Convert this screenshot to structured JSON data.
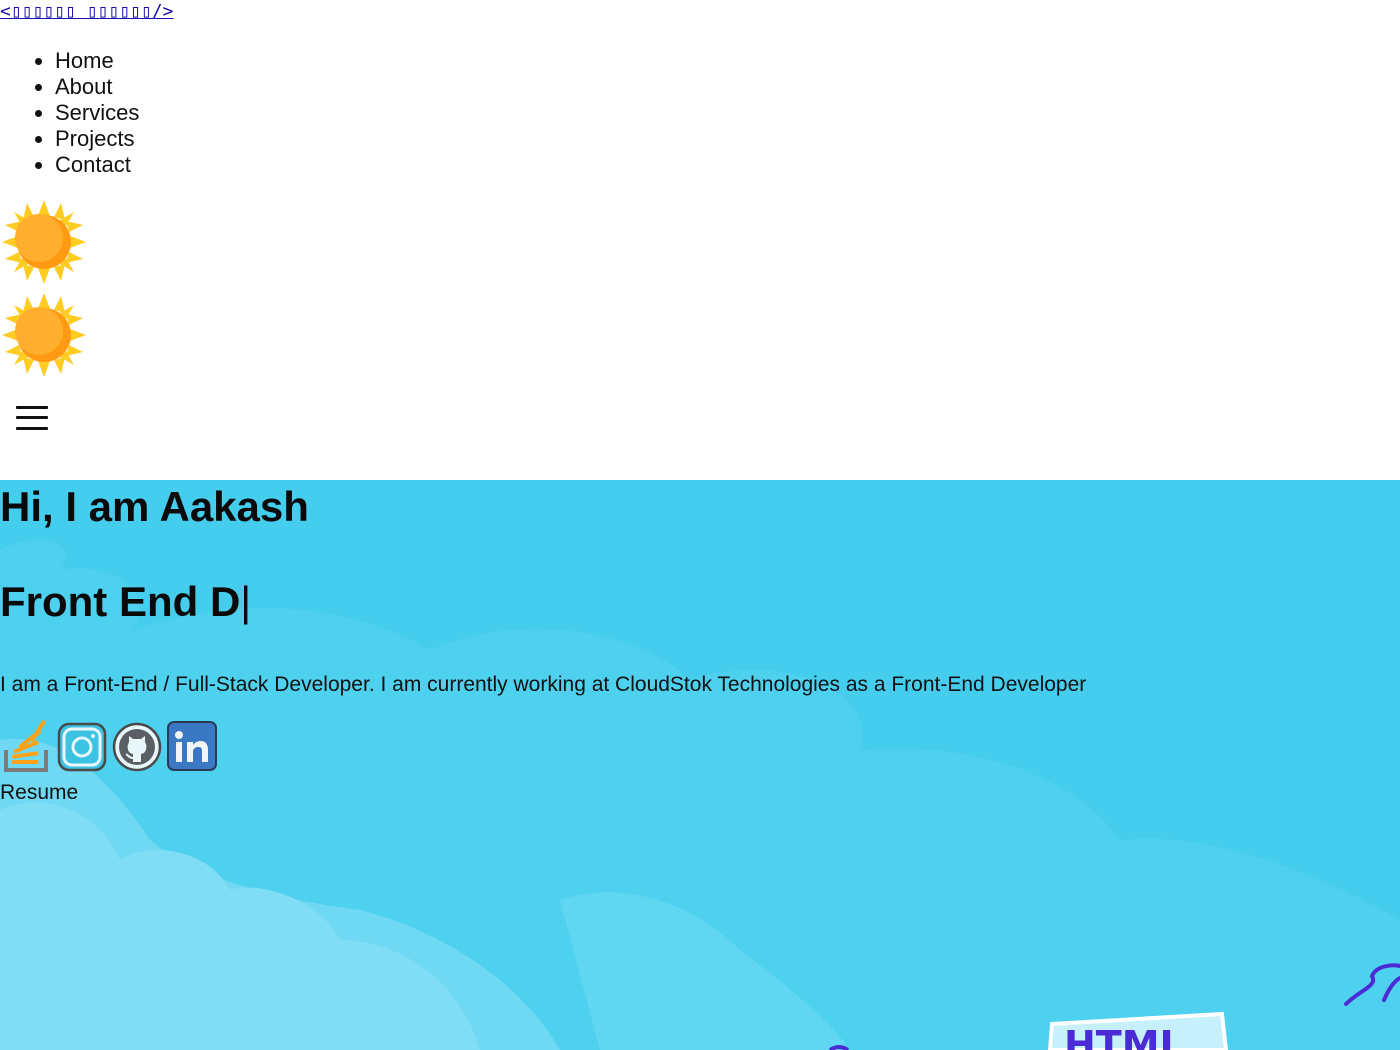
{
  "header": {
    "brand": "<▯▯▯▯▯▯ ▯▯▯▯▯▯/>",
    "nav": [
      {
        "label": "Home"
      },
      {
        "label": "About"
      },
      {
        "label": "Services"
      },
      {
        "label": "Projects"
      },
      {
        "label": "Contact"
      }
    ]
  },
  "icons": {
    "theme_toggle": "sun-icon",
    "menu": "hamburger-menu-icon",
    "socials": [
      "stackoverflow-icon",
      "instagram-icon",
      "github-icon",
      "linkedin-icon"
    ]
  },
  "hero": {
    "title": "Hi, I am Aakash",
    "typed_text": "Front End D",
    "cursor": "|",
    "description": "I am a Front-End / Full-Stack Developer. I am currently working at CloudStok Technologies as a Front-End Developer",
    "resume_label": "Resume",
    "illustration_text": "HTML"
  },
  "colors": {
    "hero_bg": "#45cdee",
    "cloud_light": "#7fddf5",
    "sun": "#ffa61a",
    "sun_rays": "#ffcc22",
    "accent_purple": "#4b2bd6"
  }
}
